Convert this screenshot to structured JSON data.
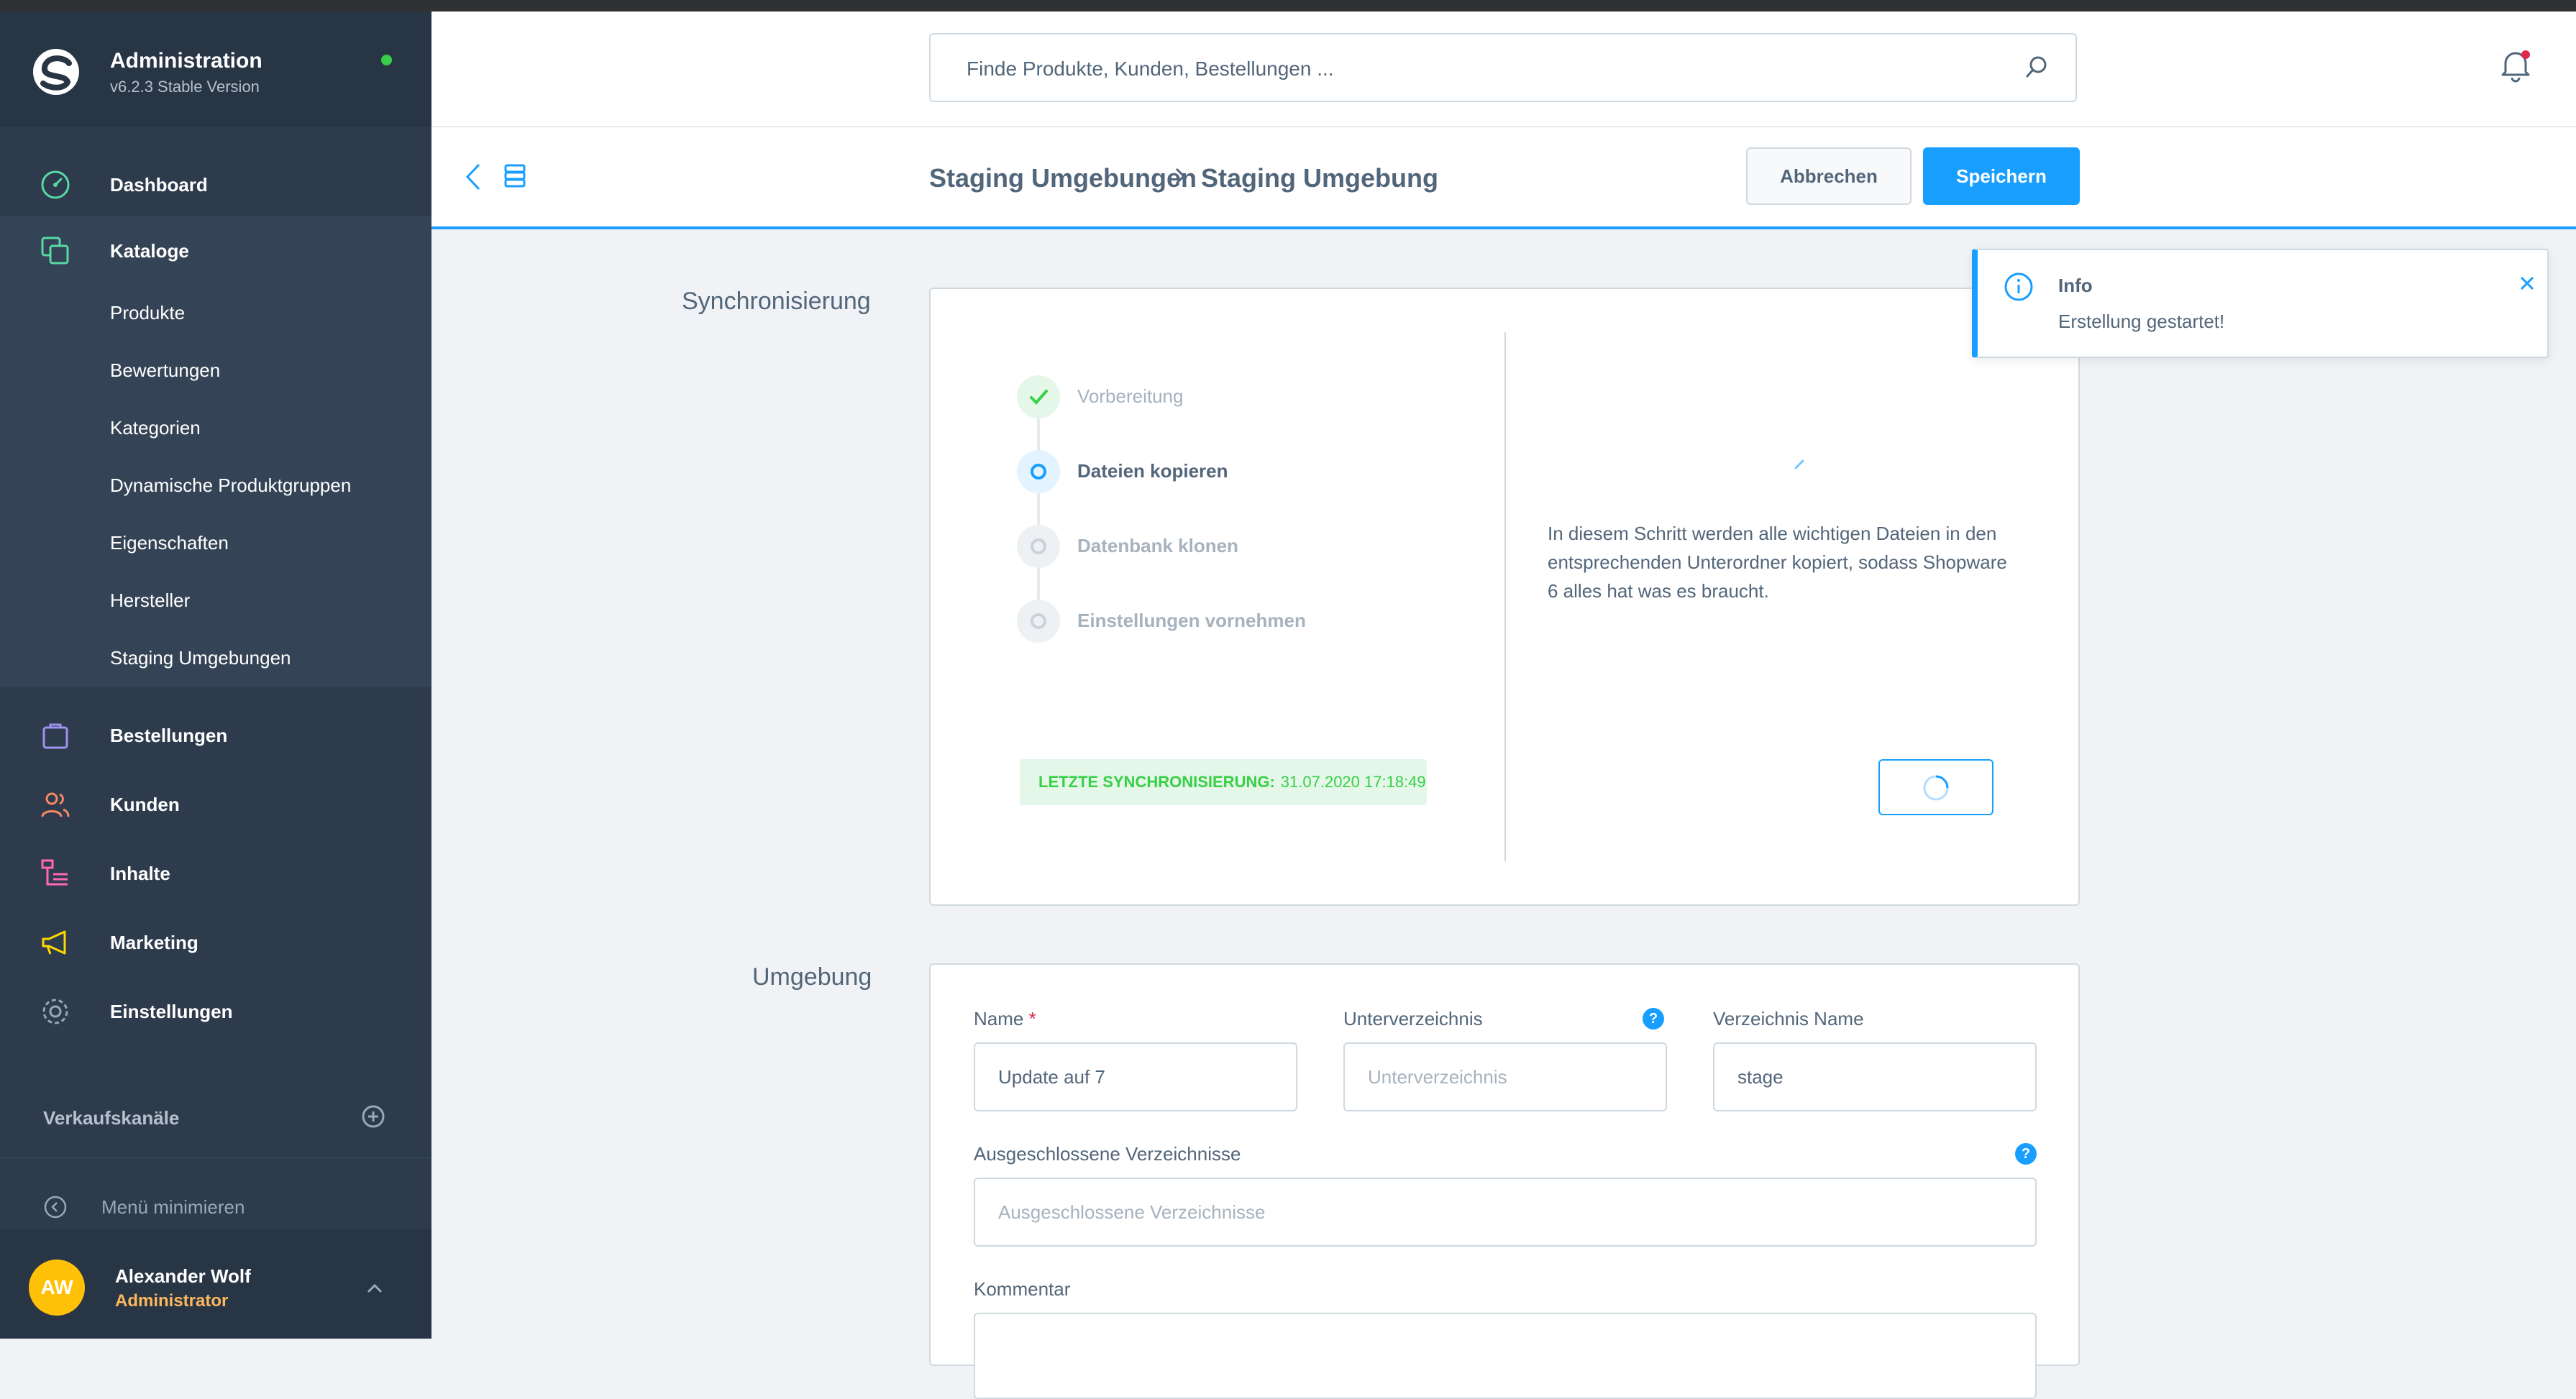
{
  "app": {
    "name": "Administration",
    "version": "v6.2.3 Stable Version",
    "status_color": "#37d046"
  },
  "sidebar": {
    "items": [
      {
        "key": "dashboard",
        "label": "Dashboard",
        "icon": "gauge-icon",
        "color": "#57d9a3"
      },
      {
        "key": "catalogues",
        "label": "Kataloge",
        "icon": "catalog-icon",
        "color": "#57d9a3"
      },
      {
        "key": "orders",
        "label": "Bestellungen",
        "icon": "shopping-bag-icon",
        "color": "#a092f0"
      },
      {
        "key": "customers",
        "label": "Kunden",
        "icon": "users-icon",
        "color": "#f88962"
      },
      {
        "key": "content",
        "label": "Inhalte",
        "icon": "content-icon",
        "color": "#ff68b4"
      },
      {
        "key": "marketing",
        "label": "Marketing",
        "icon": "megaphone-icon",
        "color": "#ffd700"
      },
      {
        "key": "settings",
        "label": "Einstellungen",
        "icon": "gear-icon",
        "color": "#9aa8b5"
      }
    ],
    "catalog_sub_items": [
      "Produkte",
      "Bewertungen",
      "Kategorien",
      "Dynamische Produktgruppen",
      "Eigenschaften",
      "Hersteller",
      "Staging Umgebungen"
    ],
    "sales_channels_label": "Verkaufskanäle",
    "minimize_label": "Menü minimieren"
  },
  "user": {
    "initials": "AW",
    "name": "Alexander Wolf",
    "role": "Administrator"
  },
  "search": {
    "placeholder": "Finde Produkte, Kunden, Bestellungen ..."
  },
  "header": {
    "breadcrumb_parent": "Staging Umgebungen",
    "breadcrumb_current": "Staging Umgebung",
    "cancel_label": "Abbrechen",
    "save_label": "Speichern",
    "accent_color": "#189eff"
  },
  "sync": {
    "section_title": "Synchronisierung",
    "steps": [
      {
        "label": "Vorbereitung",
        "state": "done"
      },
      {
        "label": "Dateien kopieren",
        "state": "active"
      },
      {
        "label": "Datenbank klonen",
        "state": "pending"
      },
      {
        "label": "Einstellungen vornehmen",
        "state": "pending"
      }
    ],
    "last_sync_label": "LETZTE SYNCHRONISIERUNG:",
    "last_sync_value": "31.07.2020 17:18:49",
    "description": "In diesem Schritt werden alle wichtigen Dateien in den entsprechenden Unterordner kopiert, sodass Shopware 6 alles hat was es braucht."
  },
  "environment": {
    "section_title": "Umgebung",
    "fields": {
      "name_label": "Name",
      "name_required_mark": "*",
      "name_value": "Update auf 7",
      "subdir_label": "Unterverzeichnis",
      "subdir_placeholder": "Unterverzeichnis",
      "dirname_label": "Verzeichnis Name",
      "dirname_value": "stage",
      "excluded_label": "Ausgeschlossene Verzeichnisse",
      "excluded_placeholder": "Ausgeschlossene Verzeichnisse",
      "comment_label": "Kommentar"
    },
    "help_glyph": "?"
  },
  "notification": {
    "title": "Info",
    "message": "Erstellung gestartet!"
  }
}
